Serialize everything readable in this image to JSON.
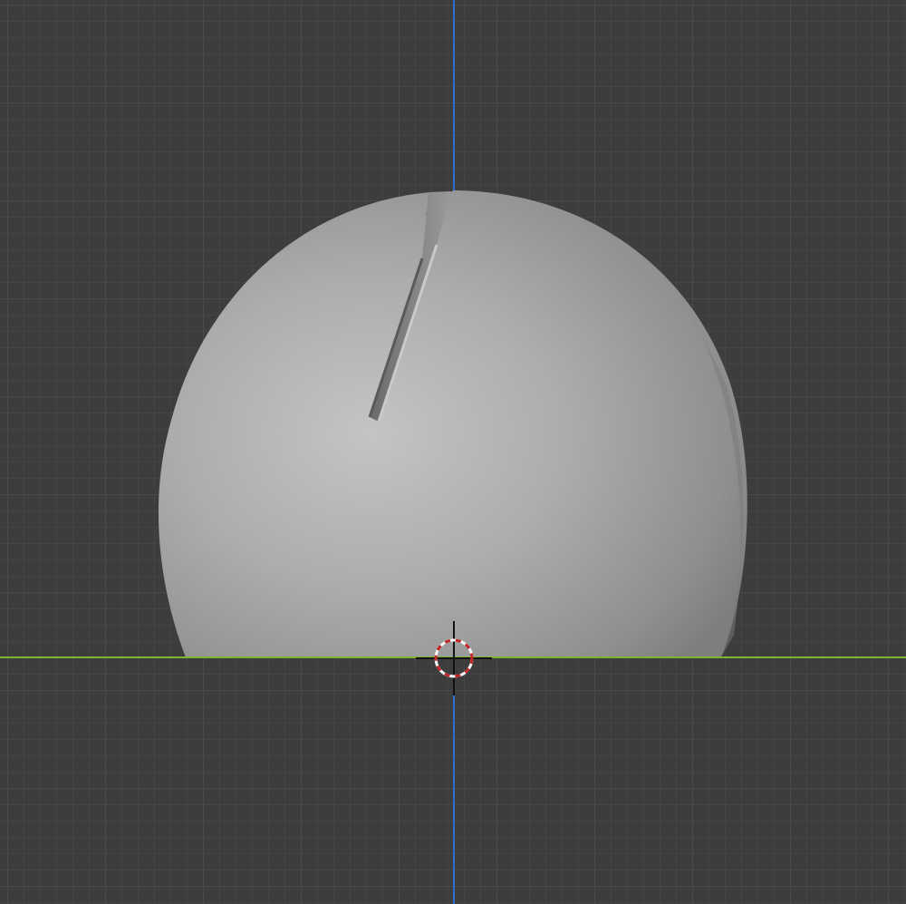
{
  "viewport": {
    "view": "front-orthographic",
    "background_color": "#3d3d3d",
    "grid_color_minor": "#4a4a4a",
    "grid_color_major": "#555555",
    "x_axis_color": "#80b32e",
    "z_axis_color": "#2b6fcf",
    "object_color": "#a8a8a8",
    "cursor_color": "#c22626"
  },
  "object": {
    "type": "sphere-cut",
    "shading": "solid"
  },
  "cursor": {
    "icon": "3d-cursor-icon"
  }
}
